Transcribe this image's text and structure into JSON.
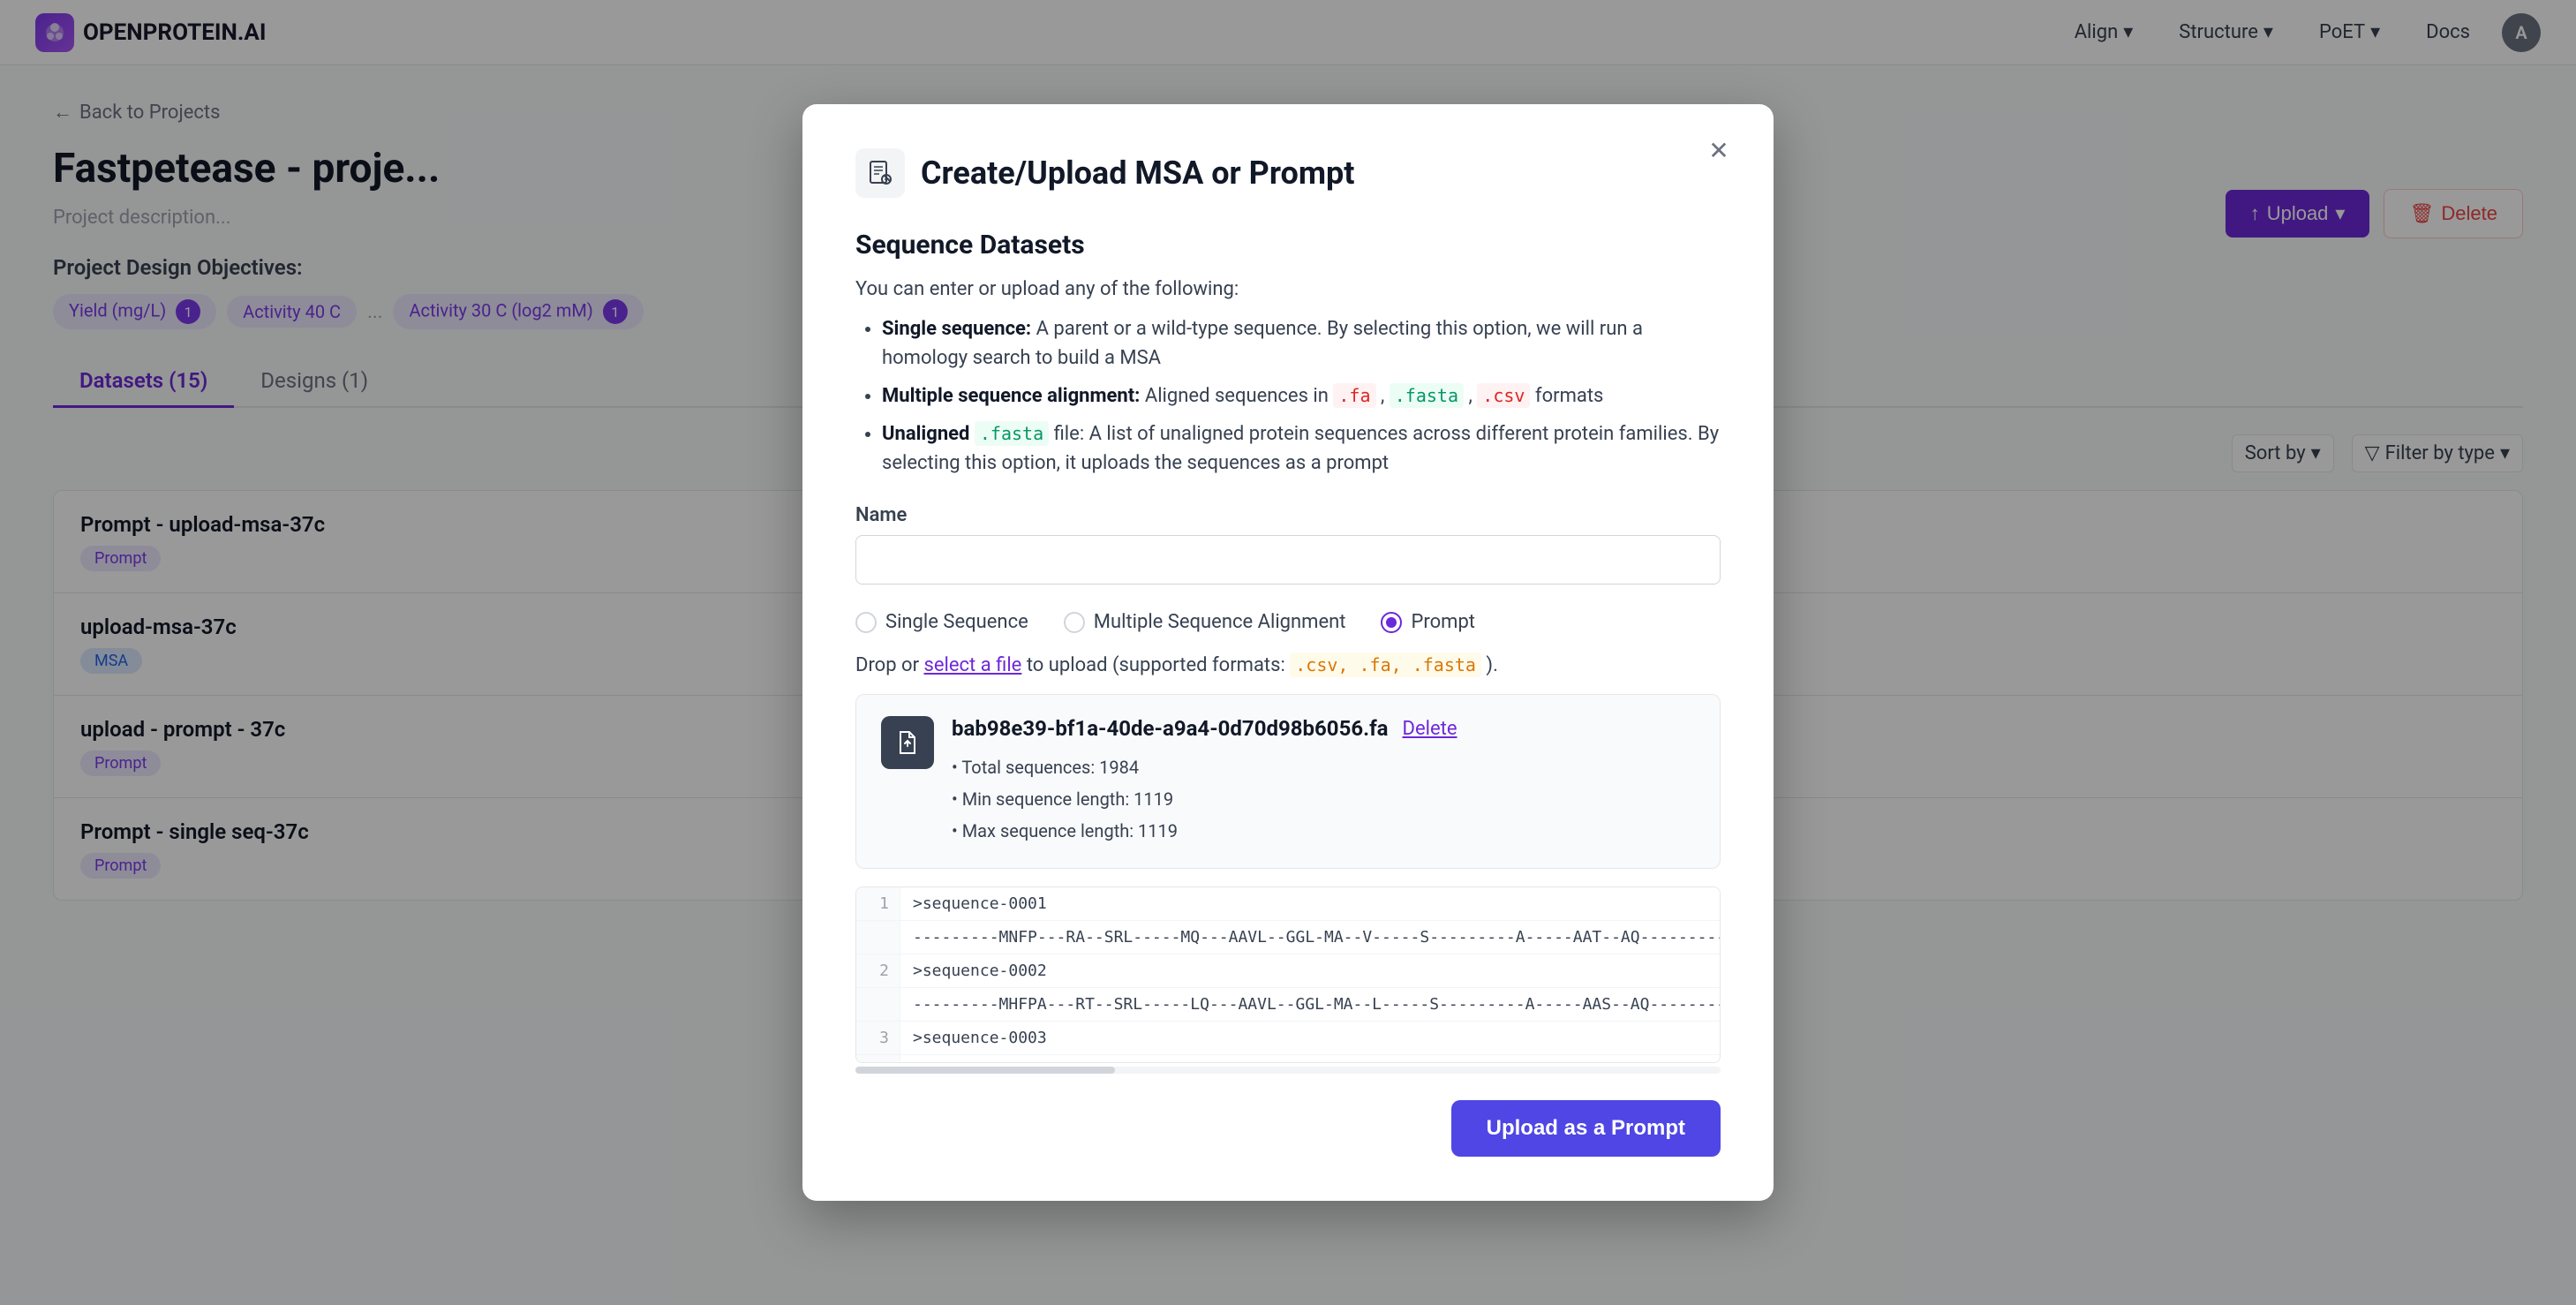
{
  "app": {
    "name": "OPENPROTEIN.AI",
    "avatar": "A"
  },
  "nav": {
    "align_label": "Align",
    "structure_label": "Structure",
    "poet_label": "PoET",
    "docs_label": "Docs"
  },
  "page": {
    "back_label": "Back to Projects",
    "title": "Fastpetease - proje...",
    "description_placeholder": "Project description...",
    "objectives_label": "Project Design Objectives:",
    "objective1": "Yield (mg/L)",
    "objective1_num": "1",
    "objective2": "Activity 40 C",
    "objective3": "Activity 30 C (log2 mM)",
    "objective3_num": "1"
  },
  "tabs": [
    {
      "label": "Datasets (15)",
      "active": true
    },
    {
      "label": "Designs (1)",
      "active": false
    }
  ],
  "action_buttons": {
    "upload_label": "Upload",
    "delete_label": "Delete"
  },
  "list_controls": {
    "sort_by_label": "Sort by",
    "filter_label": "Filter by type"
  },
  "datasets": [
    {
      "name": "Prompt - upload-msa-37c",
      "badge": "Prompt",
      "badge_type": "prompt"
    },
    {
      "name": "upload-msa-37c",
      "badge": "MSA",
      "badge_type": "msa"
    },
    {
      "name": "upload - prompt - 37c",
      "badge": "Prompt",
      "badge_type": "prompt"
    },
    {
      "name": "Prompt - single seq-37c",
      "badge": "Prompt",
      "badge_type": "prompt"
    }
  ],
  "modal": {
    "title": "Create/Upload MSA or Prompt",
    "section_title": "Sequence Datasets",
    "intro_text": "You can enter or upload any of the following:",
    "bullets": [
      {
        "label": "Single sequence:",
        "text": "A parent or a wild-type sequence. By selecting this option, we will run a homology search to build a MSA"
      },
      {
        "label": "Multiple sequence alignment:",
        "text": "Aligned sequences in ",
        "codes": [
          ".fa",
          ".fasta",
          ".csv"
        ],
        "text2": " formats"
      },
      {
        "label": "Unaligned",
        "code": ".fasta",
        "text": " file: A list of unaligned protein sequences across different protein families. By selecting this option, it uploads the sequences as a prompt"
      }
    ],
    "name_label": "Name",
    "name_placeholder": "",
    "radio_options": [
      {
        "label": "Single Sequence",
        "checked": false
      },
      {
        "label": "Multiple Sequence Alignment",
        "checked": false
      },
      {
        "label": "Prompt",
        "checked": true
      }
    ],
    "drop_text_prefix": "Drop or ",
    "drop_link": "select a file",
    "drop_text_suffix": " to upload (supported formats: ",
    "drop_formats": ".csv, .fa, .fasta",
    "drop_text_end": ").",
    "file": {
      "name": "bab98e39-bf1a-40de-a9a4-0d70d98b6056.fa",
      "delete_label": "Delete",
      "total_sequences": "Total sequences: 1984",
      "min_length": "Min sequence length: 1119",
      "max_length": "Max sequence length: 1119"
    },
    "sequences": [
      {
        "num": "1",
        "header": ">sequence-0001",
        "seq": "---------MNFP---RA--SRL-----MQ---AAVL--GGL-MA--V-----S---------A-----AAT--AQ------------"
      },
      {
        "num": "2",
        "header": ">sequence-0002",
        "seq": "---------MHFPA---RT--SRL-----LQ---AAVL--GGL-MA--L-----S---------A-----AAS--AQ------------"
      },
      {
        "num": "3",
        "header": ">sequence-0003",
        "seq": ""
      }
    ],
    "upload_button_label": "Upload as a Prompt"
  }
}
